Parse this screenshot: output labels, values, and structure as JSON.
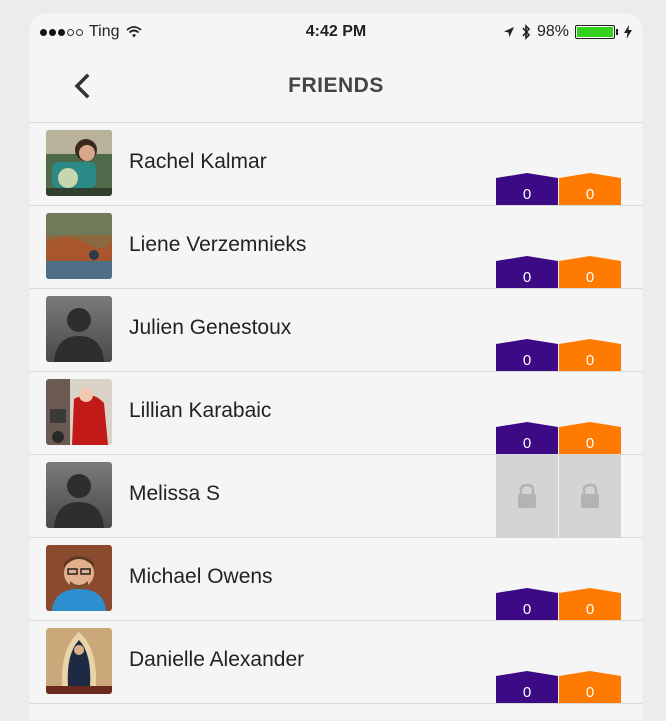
{
  "status_bar": {
    "signal_dots": [
      true,
      true,
      true,
      false,
      false
    ],
    "carrier": "Ting",
    "time": "4:42 PM",
    "battery": "98%",
    "battery_level": 0.98
  },
  "nav": {
    "title": "FRIENDS",
    "back_icon": "chevron-left-icon"
  },
  "colors": {
    "purple": "#3d0a86",
    "orange": "#ff7a00",
    "battery": "#33d21f",
    "lock": "#d4d4d4"
  },
  "friends": [
    {
      "name": "Rachel Kalmar",
      "locked": false,
      "purple": "0",
      "orange": "0"
    },
    {
      "name": "Liene Verzemnieks",
      "locked": false,
      "purple": "0",
      "orange": "0"
    },
    {
      "name": "Julien Genestoux",
      "locked": false,
      "purple": "0",
      "orange": "0"
    },
    {
      "name": "Lillian Karabaic",
      "locked": false,
      "purple": "0",
      "orange": "0"
    },
    {
      "name": "Melissa S",
      "locked": true
    },
    {
      "name": "Michael Owens",
      "locked": false,
      "purple": "0",
      "orange": "0"
    },
    {
      "name": "Danielle Alexander",
      "locked": false,
      "purple": "0",
      "orange": "0"
    }
  ]
}
